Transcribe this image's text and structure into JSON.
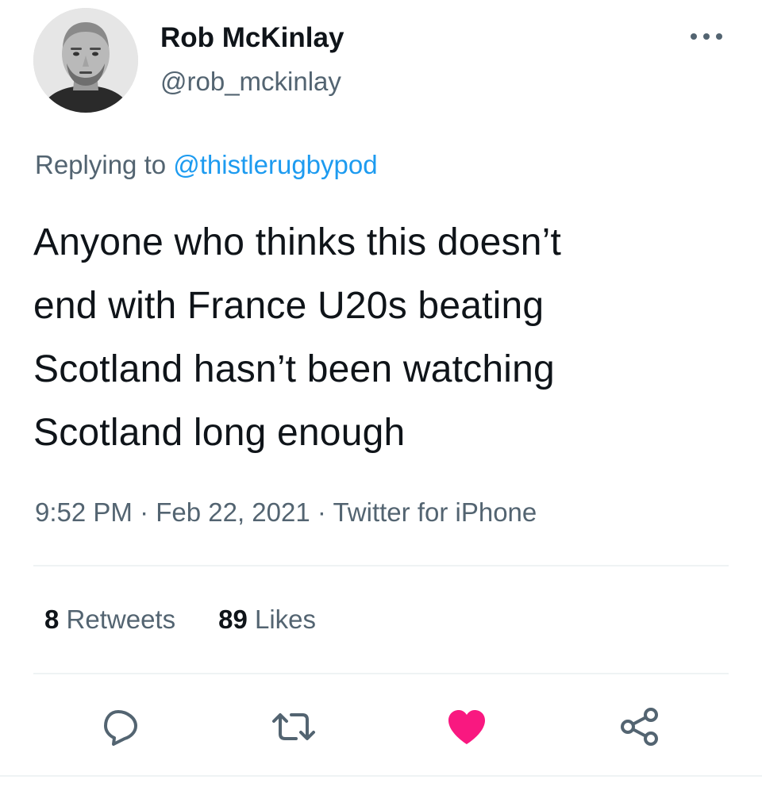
{
  "author": {
    "name": "Rob McKinlay",
    "handle": "@rob_mckinlay"
  },
  "replying": {
    "prefix": "Replying to ",
    "mention": "@thistlerugbypod"
  },
  "tweet": {
    "lines": [
      "Anyone who thinks this doesn’t",
      "end with France U20s beating",
      "Scotland hasn’t been watching",
      "Scotland long enough"
    ]
  },
  "meta": {
    "time": "9:52 PM",
    "sep1": " · ",
    "date": "Feb 22, 2021",
    "sep2": " · ",
    "source": "Twitter for iPhone"
  },
  "stats": {
    "retweets_count": "8",
    "retweets_label": " Retweets",
    "likes_count": "89",
    "likes_label": " Likes"
  },
  "icons": {
    "more": "more-horizontal-icon",
    "reply": "speech-bubble-icon",
    "retweet": "retweet-arrows-icon",
    "like": "heart-icon",
    "share": "share-nodes-icon"
  },
  "colors": {
    "like_active": "#f91880",
    "link": "#1d9bf0",
    "secondary_text": "#536471",
    "icon_gray": "#536471"
  },
  "state": {
    "liked": true
  }
}
